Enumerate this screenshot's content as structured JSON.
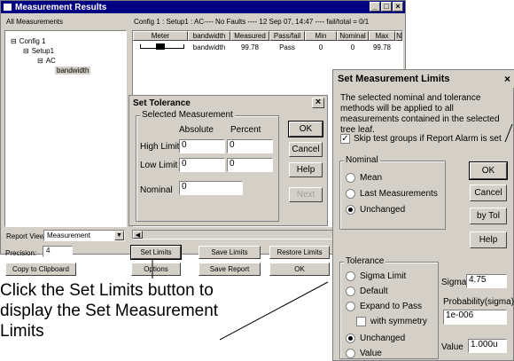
{
  "main": {
    "title": "Measurement Results",
    "all_measurements": "All Measurements",
    "status_line": "Config 1 : Setup1 : AC---- No Faults ---- 12 Sep 07, 14:47 ---- fail/total = 0/1",
    "tree": [
      "Config 1",
      "Setup1",
      "AC",
      "bandwidth"
    ],
    "columns": [
      "Meter",
      "bandwidth",
      "Measured",
      "Pass/fail",
      "Min",
      "Nominal",
      "Max",
      "N"
    ],
    "row": {
      "name": "bandwidth",
      "measured": "99.78",
      "pass": "Pass",
      "min": "0",
      "nominal": "0",
      "max": "99.78"
    },
    "report_view_label": "Report View:",
    "report_view_value": "Measurement",
    "precision_label": "Precision:",
    "precision_value": "4",
    "buttons": {
      "copy": "Copy to Clipboard",
      "set_limits": "Set Limits",
      "save_limits": "Save Limits",
      "restore_limits": "Restore Limits",
      "options": "Options",
      "save_report": "Save Report",
      "ok": "OK"
    }
  },
  "tolerance": {
    "title": "Set Tolerance",
    "group": "Selected Measurement",
    "absolute": "Absolute",
    "percent": "Percent",
    "high": "High Limit",
    "low": "Low Limit",
    "nominal": "Nominal",
    "high_abs": "0",
    "high_pct": "0",
    "low_abs": "0",
    "low_pct": "0",
    "nominal_val": "0",
    "ok": "OK",
    "cancel": "Cancel",
    "help": "Help",
    "next": "Next"
  },
  "limits": {
    "title": "Set Measurement Limits",
    "desc": "The selected nominal and tolerance methods will be applied to all measurements contained in the selected tree leaf.",
    "skip": "Skip test groups if Report Alarm is set",
    "nominal_group": "Nominal",
    "nominal_options": [
      "Mean",
      "Last Measurements",
      "Unchanged"
    ],
    "tolerance_group": "Tolerance",
    "tolerance_options": [
      "Sigma Limit",
      "Default",
      "Expand to Pass"
    ],
    "with_symmetry": "with symmetry",
    "tolerance_options2": [
      "Unchanged",
      "Value"
    ],
    "ok": "OK",
    "cancel": "Cancel",
    "bytol": "by Tol",
    "help": "Help",
    "sigma_label": "Sigma",
    "sigma_value": "4.75",
    "prob_label": "Probability(sigma)",
    "prob_value": "1e-006",
    "value_label": "Value",
    "value_value": "1.000u"
  },
  "caption": "Click the Set Limits button to display the Set Measurement Limits"
}
